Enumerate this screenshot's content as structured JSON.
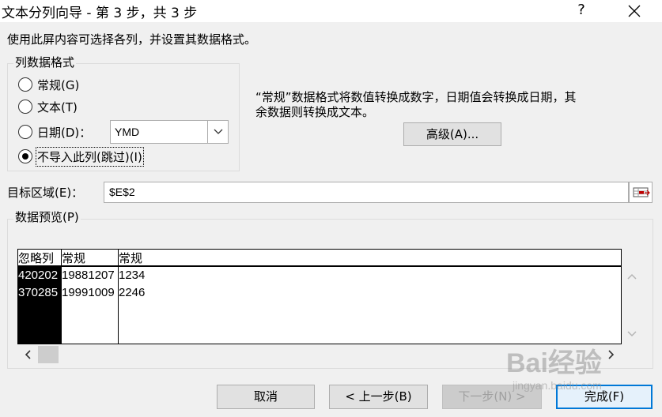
{
  "window": {
    "title": "文本分列向导 - 第 3 步，共 3 步",
    "help_label": "?"
  },
  "instruction": "使用此屏内容可选择各列，并设置其数据格式。",
  "column_format": {
    "group_label": "列数据格式",
    "options": [
      {
        "label": "常规(G)",
        "checked": false
      },
      {
        "label": "文本(T)",
        "checked": false
      },
      {
        "label": "日期(D)：",
        "checked": false
      },
      {
        "label": "不导入此列(跳过)(I)",
        "checked": true
      }
    ],
    "date_format_value": "YMD"
  },
  "description": {
    "line1": "“常规”数据格式将数值转换成数字，日期值会转换成日期，其",
    "line2": "余数据则转换成文本。"
  },
  "advanced_button": "高级(A)...",
  "destination": {
    "label": "目标区域(E)：",
    "value": "$E$2"
  },
  "preview": {
    "group_label": "数据预览(P)",
    "columns": [
      {
        "header": "忽略列",
        "cells": [
          "420202",
          "370285"
        ],
        "selected": true
      },
      {
        "header": "常规",
        "cells": [
          "19881207",
          "19991009"
        ],
        "selected": false
      },
      {
        "header": "常规",
        "cells": [
          "1234",
          "2246"
        ],
        "selected": false
      }
    ]
  },
  "buttons": {
    "cancel": "取消",
    "back": "< 上一步(B)",
    "next": "下一步(N) >",
    "finish": "完成(F)"
  },
  "watermark": {
    "line1": "Bai经验",
    "line2": "jingyan.baidu.com"
  },
  "colors": {
    "accent": "#0078d7",
    "dialog_bg": "#f0f0f0"
  }
}
